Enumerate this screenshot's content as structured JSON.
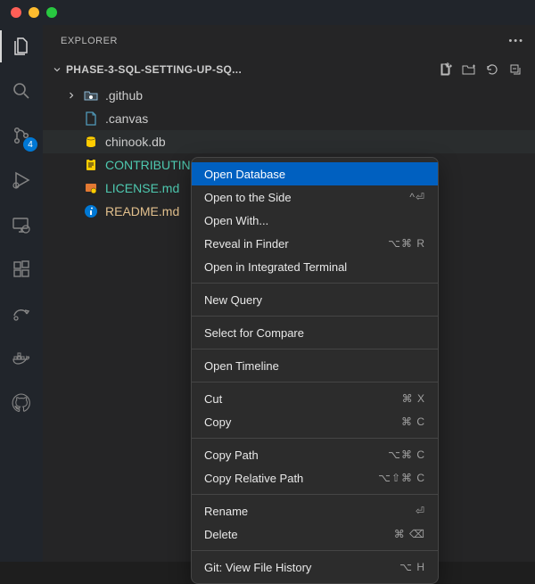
{
  "traffic": {
    "close": "#ff5f57",
    "min": "#febc2e",
    "max": "#28c840"
  },
  "activitybar": {
    "items": [
      {
        "name": "files-icon",
        "active": true
      },
      {
        "name": "search-icon"
      },
      {
        "name": "source-control-icon",
        "badge": "4"
      },
      {
        "name": "debug-icon"
      },
      {
        "name": "remote-explorer-icon"
      },
      {
        "name": "extensions-icon"
      },
      {
        "name": "share-icon"
      },
      {
        "name": "docker-icon"
      },
      {
        "name": "github-icon"
      }
    ]
  },
  "sidebar": {
    "header": "EXPLORER",
    "project_label": "PHASE-3-SQL-SETTING-UP-SQ...",
    "tree": {
      "folder": {
        "label": ".github",
        "icon_color": "#8bb6d4"
      },
      "files": [
        {
          "label": ".canvas",
          "icon_color": "#519aba",
          "selected": false
        },
        {
          "label": "chinook.db",
          "icon_color": "#ffcc00",
          "selected": true,
          "text_color": "#cccccc"
        },
        {
          "label": "CONTRIBUTING.md",
          "icon_color": "#ffcc00",
          "text_color": "#4ec9b0"
        },
        {
          "label": "LICENSE.md",
          "icon_color": "#e37933",
          "text_color": "#4ec9b0"
        },
        {
          "label": "README.md",
          "icon_color": "#0078d4",
          "text_color": "#e2c08d"
        }
      ]
    }
  },
  "context_menu": {
    "groups": [
      [
        {
          "label": "Open Database",
          "highlight": true
        },
        {
          "label": "Open to the Side",
          "shortcut": "^⏎"
        },
        {
          "label": "Open With..."
        },
        {
          "label": "Reveal in Finder",
          "shortcut": "⌥⌘ R"
        },
        {
          "label": "Open in Integrated Terminal"
        }
      ],
      [
        {
          "label": "New Query"
        }
      ],
      [
        {
          "label": "Select for Compare"
        }
      ],
      [
        {
          "label": "Open Timeline"
        }
      ],
      [
        {
          "label": "Cut",
          "shortcut": "⌘ X"
        },
        {
          "label": "Copy",
          "shortcut": "⌘ C"
        }
      ],
      [
        {
          "label": "Copy Path",
          "shortcut": "⌥⌘ C"
        },
        {
          "label": "Copy Relative Path",
          "shortcut": "⌥⇧⌘ C"
        }
      ],
      [
        {
          "label": "Rename",
          "shortcut": "⏎"
        },
        {
          "label": "Delete",
          "shortcut": "⌘ ⌫"
        }
      ],
      [
        {
          "label": "Git: View File History",
          "shortcut": "⌥ H"
        }
      ]
    ]
  }
}
